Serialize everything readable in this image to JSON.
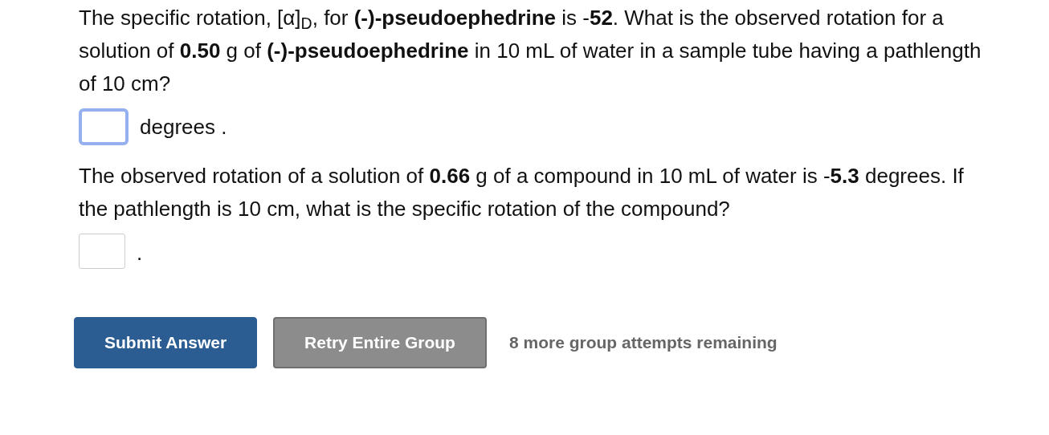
{
  "questions": [
    {
      "text": "The specific rotation, [α]$_{D}$, for **(-)-pseudoephedrine** is -**52**. What is the observed rotation for a solution of **0.50** g of **(-)-pseudoephedrine** in 10 mL of water in a sample tube having a pathlength of 10 cm?",
      "answer": {
        "focused": true,
        "unit": "degrees ."
      }
    },
    {
      "text": "The observed rotation of a solution of **0.66** g of a compound in 10 mL of water is -**5.3** degrees. If the pathlength is 10 cm, what is the specific rotation of the compound?",
      "answer": {
        "focused": false,
        "unit": "."
      }
    }
  ],
  "buttons": [
    {
      "label": "Submit Answer",
      "kind": "primary"
    },
    {
      "label": "Retry Entire Group",
      "kind": "secondary"
    }
  ],
  "attempts": "8 more group attempts remaining"
}
